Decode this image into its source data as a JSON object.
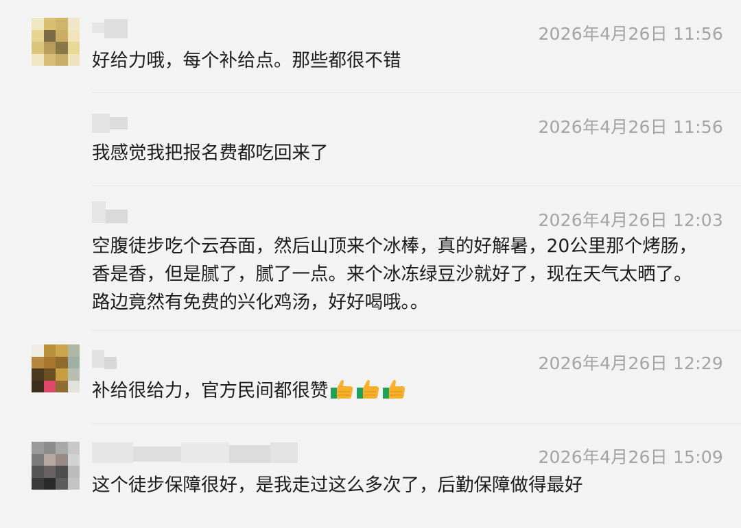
{
  "comments": [
    {
      "time": "2026年4月26日 11:56",
      "text": "好给力哦，每个补给点。那些都很不错"
    },
    {
      "time": "2026年4月26日 11:56",
      "text": "我感觉我把报名费都吃回来了"
    },
    {
      "time": "2026年4月26日 12:03",
      "lines": [
        "空腹徒步吃个云吞面，然后山顶来个冰棒，真的好解暑，20公里那个烤肠，",
        "香是香，但是腻了，腻了一点。来个冰冻绿豆沙就好了，现在天气太晒了。",
        "路边竟然有免费的兴化鸡汤，好好喝哦。。"
      ]
    },
    {
      "time": "2026年4月26日 12:29",
      "text": "补给很给力，官方民间都很赞",
      "emoji": [
        "thumbs-up-emoji",
        "thumbs-up-emoji",
        "thumbs-up-emoji"
      ]
    },
    {
      "time": "2026年4月26日 15:09",
      "text": "这个徒步保障很好，是我走过这么多次了，后勤保障做得最好"
    }
  ],
  "colors": {
    "background": "#f3f3f3",
    "timestamp": "#a3a3a3",
    "text": "#1c1c1c",
    "divider": "#e4e4e4"
  }
}
